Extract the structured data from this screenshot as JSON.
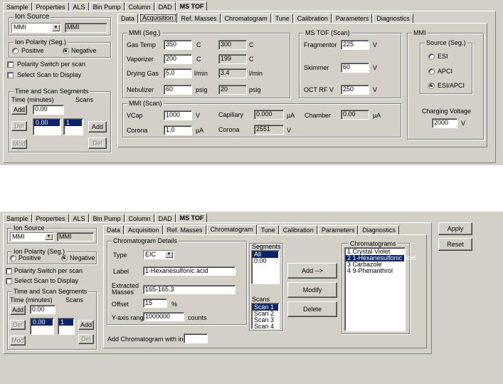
{
  "tabs": [
    "Sample",
    "Properties",
    "ALS",
    "Bin Pump",
    "Column",
    "DAD",
    "MS TOF"
  ],
  "subtabs": [
    "Data",
    "Acquisition",
    "Ref. Masses",
    "Chromatogram",
    "Tune",
    "Calibration",
    "Parameters",
    "Diagnostics"
  ],
  "left": {
    "ion_source_label": "Ion Source",
    "ion_source_value": "MMI",
    "ion_source_readout": "MMI",
    "polarity_label": "Ion Polarity (Seg.)",
    "positive": "Positive",
    "negative": "Negative",
    "polarity_switch": "Polarity Switch per scan",
    "select_scan": "Select Scan to Display",
    "segments_label": "Time and Scan Segments",
    "time_label": "Time  (minutes)",
    "scans_label": "Scans",
    "add": "Add",
    "del": "Del",
    "mod": "Mod",
    "time_value": "0.00",
    "time_list": [
      "0.00"
    ],
    "scans_list": [
      "1"
    ]
  },
  "acq": {
    "mmi_seg_label": "MMI (Seg.)",
    "gas_temp": "Gas Temp",
    "gas_temp_set": "350",
    "gas_temp_act": "300",
    "c": "C",
    "vaporizer": "Vaporizer",
    "vaporizer_set": "200",
    "vaporizer_act": "199",
    "drying_gas": "Drying Gas",
    "drying_gas_set": "5.0",
    "drying_gas_act": "3.4",
    "lmin": "l/min",
    "nebulizer": "Nebulizer",
    "nebulizer_set": "60",
    "nebulizer_act": "20",
    "psig": "psig",
    "mstof_label": "MS TOF (Scan)",
    "fragmentor": "Fragmentor",
    "fragmentor_val": "225",
    "skimmer": "Skimmer",
    "skimmer_val": "60",
    "octrf": "OCT RF V",
    "octrf_val": "250",
    "v": "V",
    "mmi_scan_label": "MMI (Scan)",
    "vcap": "VCap",
    "vcap_val": "1000",
    "capillary": "Capillary",
    "capillary_val": "0.000",
    "ua": "µA",
    "chamber": "Chamber",
    "chamber_val": "0.00",
    "corona": "Corona",
    "corona_val": "1.0",
    "corona2": "Corona",
    "corona2_val": "2551",
    "mmi_label": "MMI",
    "source_seg": "Source (Seg.)",
    "esi": "ESI",
    "apci": "APCI",
    "esiapci": "ESI/APCI",
    "charging_voltage": "Charging Voltage",
    "charging_val": "2000"
  },
  "chrom": {
    "details_label": "Chromatogram Details",
    "type": "Type",
    "type_val": "EIC",
    "label": "Label",
    "label_val": "1-Hexanesulfonic acid",
    "extracted": "Extracted",
    "masses": "Masses",
    "masses_val": "165-165.3",
    "offset": "Offset",
    "offset_val": "15",
    "pct": "%",
    "yaxis": "Y-axis range",
    "yaxis_val": "1000000",
    "counts": "counts",
    "add_index": "Add Chromatogram with index",
    "segments_label": "Segments",
    "segments": [
      "All",
      "0.00"
    ],
    "scans_label": "Scans",
    "scans": [
      "Scan 1",
      "Scan 2",
      "Scan 3",
      "Scan 4"
    ],
    "add_btn": "Add -->",
    "modify_btn": "Modify",
    "delete_btn": "Delete",
    "chromatograms_label": "Chromatograms",
    "chromatograms": [
      "1 Crystal Violet",
      "2 1-Hexanesulfonic acid",
      "3 Carbazole",
      "4 9-Phenanthrol"
    ],
    "apply": "Apply",
    "reset": "Reset"
  }
}
